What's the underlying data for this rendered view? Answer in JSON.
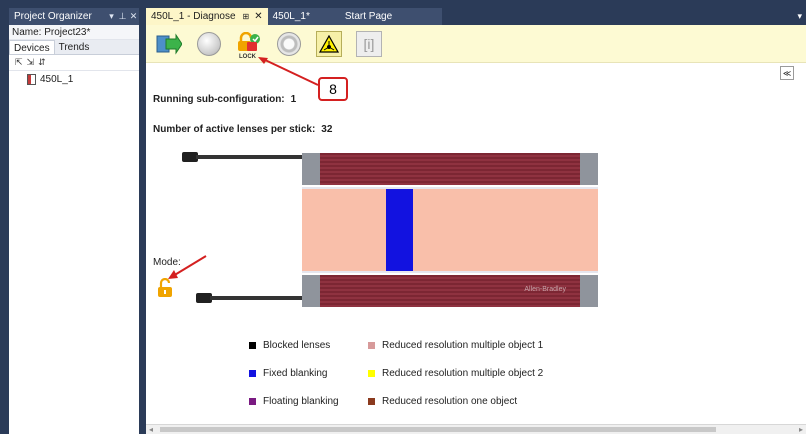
{
  "organizer": {
    "title": "Project Organizer",
    "dropdown_glyph": "▾",
    "pin_glyph": "⊥",
    "close_glyph": "✕",
    "name_label": "Name:",
    "name_value": "Project23*",
    "tabs": [
      "Devices",
      "Trends"
    ],
    "toolbar_glyphs": [
      "⇱",
      "⇲",
      "⇵"
    ],
    "tree_items": [
      "450L_1"
    ]
  },
  "tabs": [
    {
      "label": "450L_1 - Diagnose",
      "pin": "⊞",
      "close": "✕"
    },
    {
      "label": "450L_1*"
    },
    {
      "label": "Start Page"
    }
  ],
  "tab_dropdown": "▾",
  "toolbar": {
    "buttons": [
      "go-online-icon",
      "circle-icon",
      "lock-icon",
      "ring-icon",
      "laser-icon",
      "manual-icon"
    ],
    "lock_label": "LOCK",
    "manual_glyph": "[i]"
  },
  "callout_number": "8",
  "collapse_glyph": "≪",
  "running_label": "Running sub-configuration:",
  "running_value": "1",
  "lenses_label": "Number of active lenses per stick:",
  "lenses_value": "32",
  "mode_label": "Mode:",
  "brand_text": "Allen-Bradley",
  "legend": [
    {
      "label": "Blocked lenses",
      "color": "#000000"
    },
    {
      "label": "Reduced resolution multiple object 1",
      "color": "#d79a9a"
    },
    {
      "label": "Fixed blanking",
      "color": "#1212e0"
    },
    {
      "label": "Reduced resolution multiple object 2",
      "color": "#ffff00"
    },
    {
      "label": "Floating blanking",
      "color": "#7a1a82"
    },
    {
      "label": "Reduced resolution one object",
      "color": "#8b3a1e"
    }
  ],
  "scroll_left": "◂",
  "scroll_right": "▸"
}
